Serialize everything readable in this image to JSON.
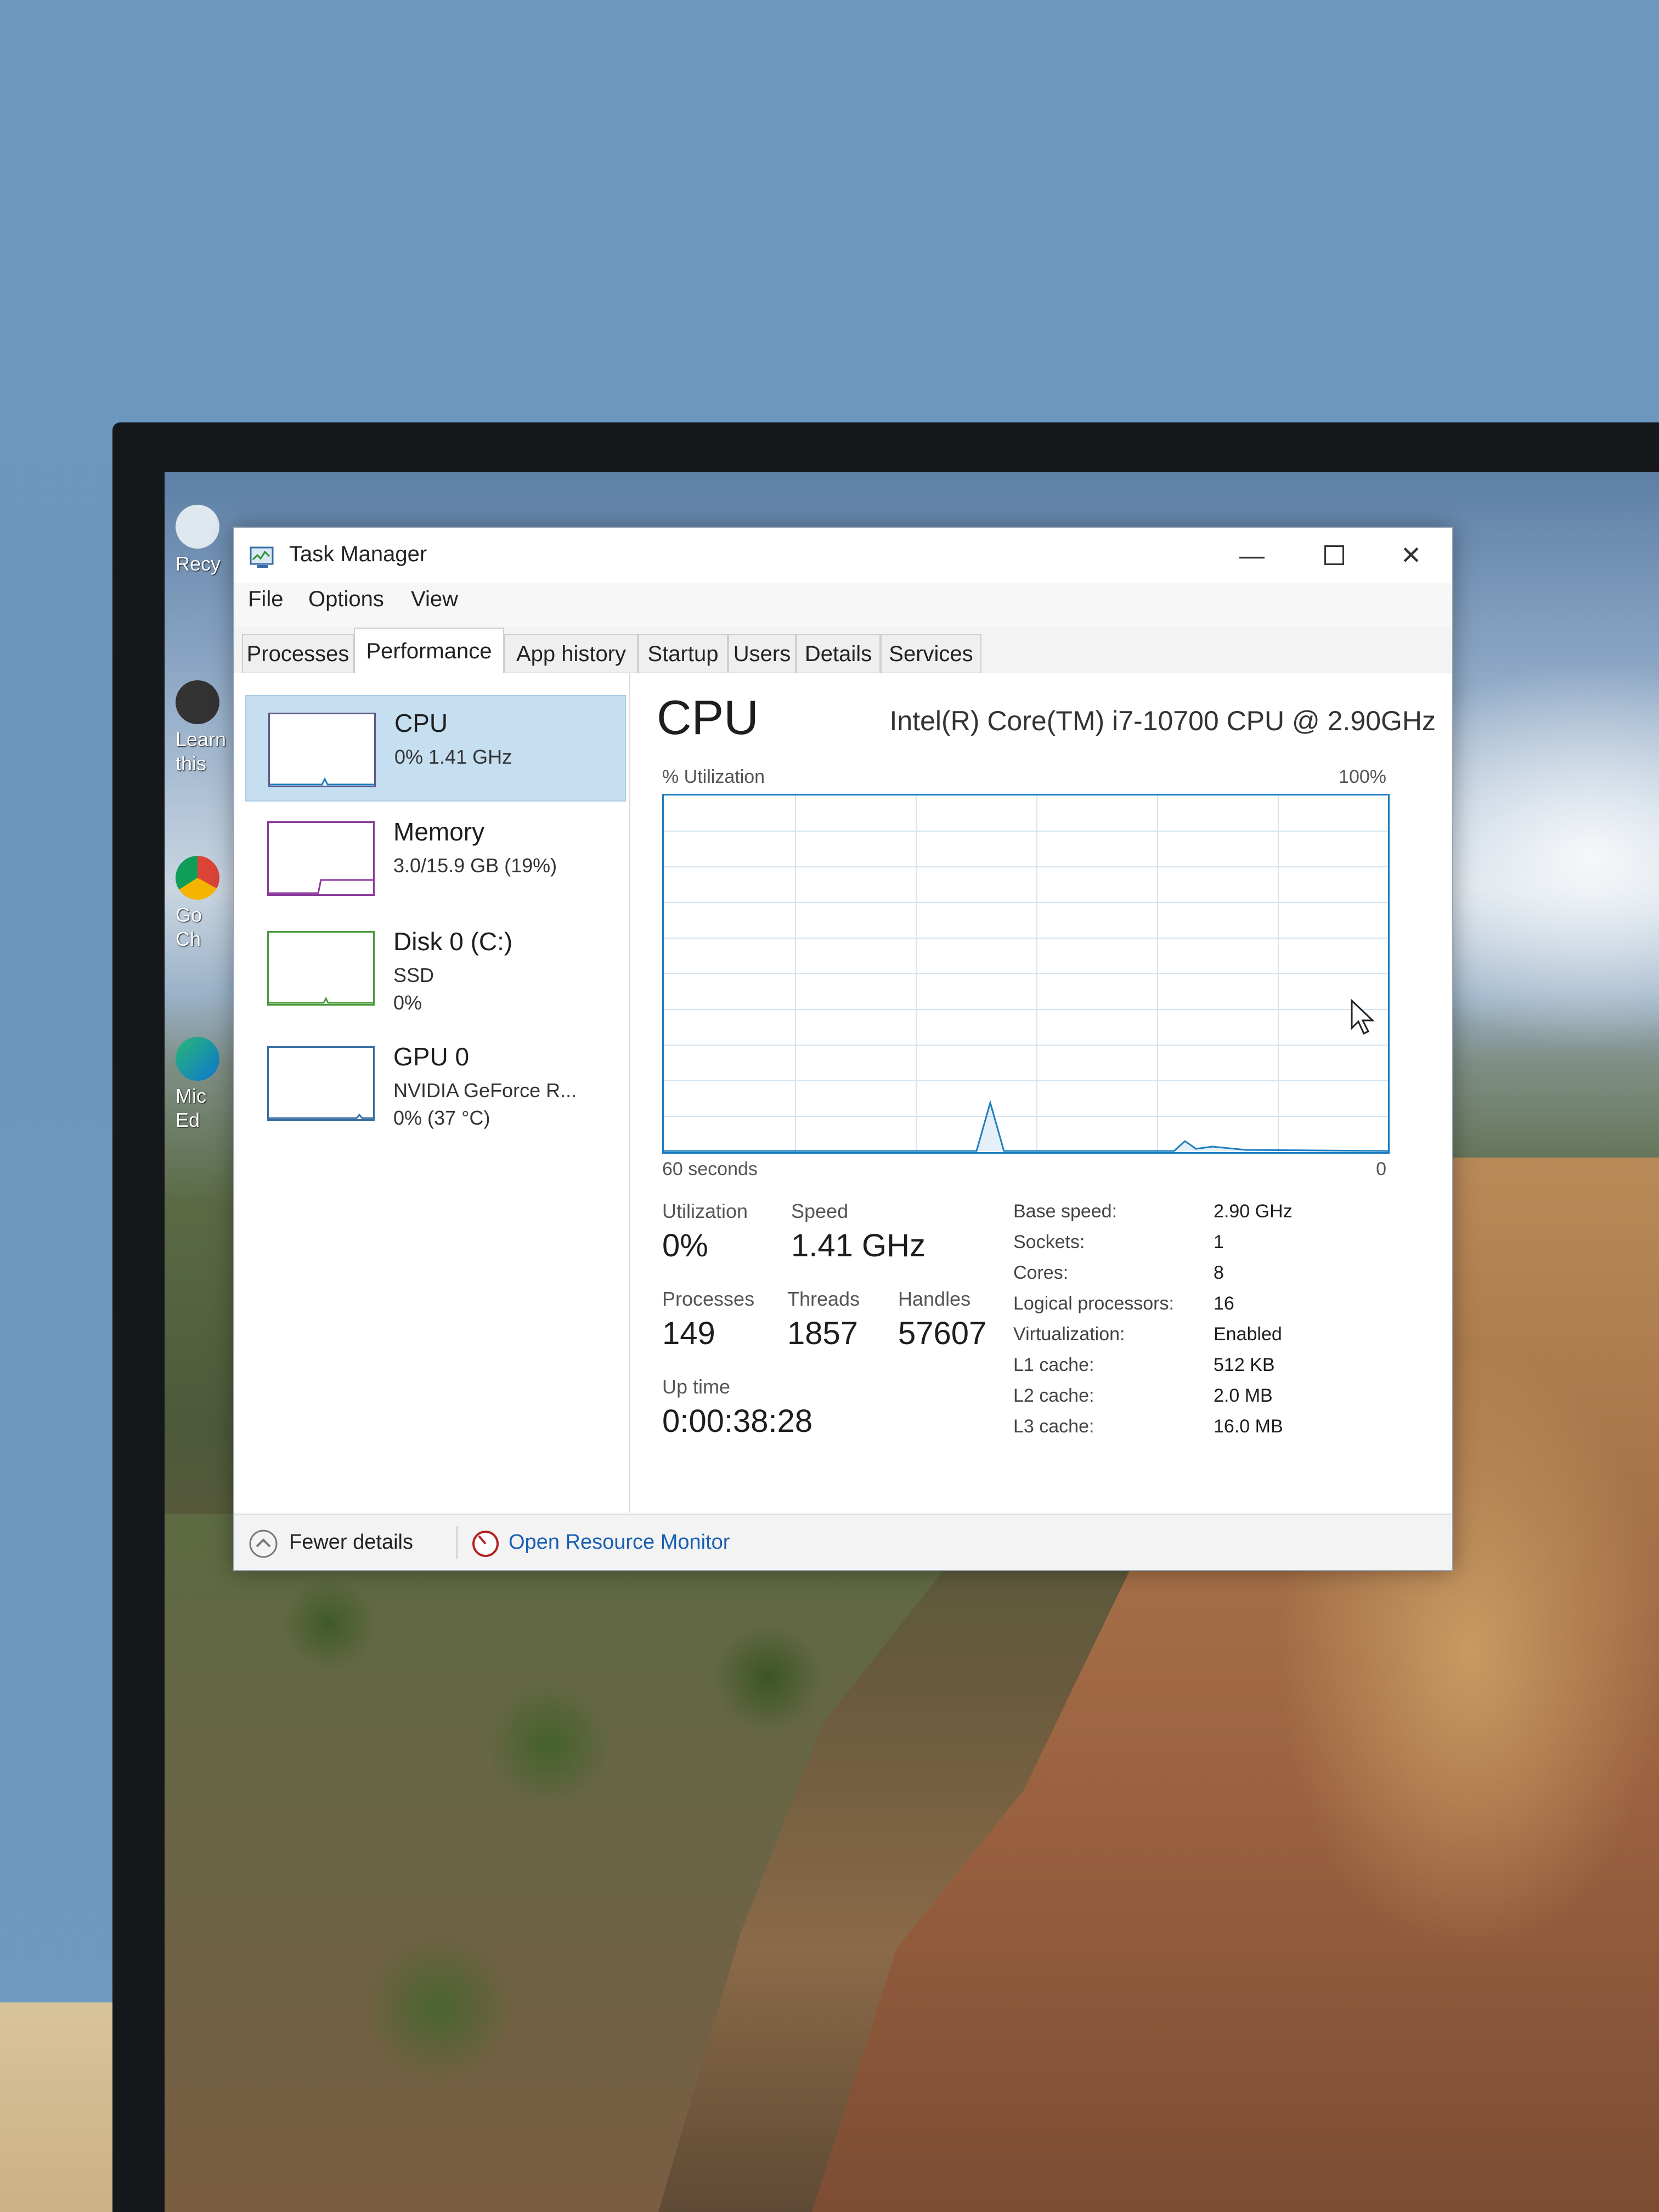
{
  "window": {
    "title": "Task Manager",
    "menu": [
      "File",
      "Options",
      "View"
    ],
    "tabs": [
      "Processes",
      "Performance",
      "App history",
      "Startup",
      "Users",
      "Details",
      "Services"
    ],
    "active_tab": "Performance"
  },
  "desktop_icons": [
    "Recy",
    "Learn this",
    "Go Ch",
    "Mic Ed"
  ],
  "resources": [
    {
      "name": "CPU",
      "sub1": "0%  1.41 GHz",
      "sub2": ""
    },
    {
      "name": "Memory",
      "sub1": "3.0/15.9 GB (19%)",
      "sub2": ""
    },
    {
      "name": "Disk 0 (C:)",
      "sub1": "SSD",
      "sub2": "0%"
    },
    {
      "name": "GPU 0",
      "sub1": "NVIDIA GeForce R...",
      "sub2": "0% (37 °C)"
    }
  ],
  "cpu": {
    "title": "CPU",
    "model": "Intel(R) Core(TM) i7-10700 CPU @ 2.90GHz",
    "graph_label": "% Utilization",
    "graph_max": "100%",
    "graph_time": "60 seconds",
    "graph_min": "0",
    "utilization_label": "Utilization",
    "utilization": "0%",
    "speed_label": "Speed",
    "speed": "1.41 GHz",
    "processes_label": "Processes",
    "processes": "149",
    "threads_label": "Threads",
    "threads": "1857",
    "handles_label": "Handles",
    "handles": "57607",
    "uptime_label": "Up time",
    "uptime": "0:00:38:28",
    "specs": [
      {
        "label": "Base speed:",
        "value": "2.90 GHz"
      },
      {
        "label": "Sockets:",
        "value": "1"
      },
      {
        "label": "Cores:",
        "value": "8"
      },
      {
        "label": "Logical processors:",
        "value": "16"
      },
      {
        "label": "Virtualization:",
        "value": "Enabled"
      },
      {
        "label": "L1 cache:",
        "value": "512 KB"
      },
      {
        "label": "L2 cache:",
        "value": "2.0 MB"
      },
      {
        "label": "L3 cache:",
        "value": "16.0 MB"
      }
    ]
  },
  "footer": {
    "fewer_details": "Fewer details",
    "resource_monitor": "Open Resource Monitor"
  },
  "colors": {
    "accent": "#1f7fc1",
    "selected_bg": "#c5def0",
    "link": "#1a5fb4"
  }
}
